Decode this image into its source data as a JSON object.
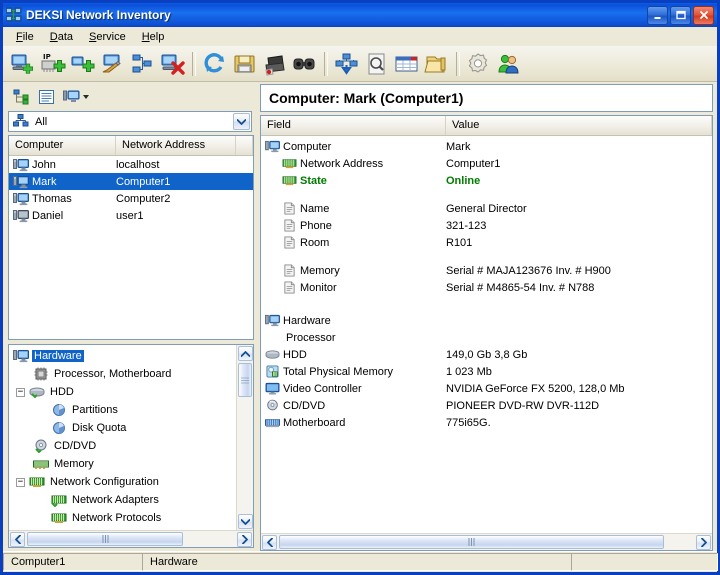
{
  "window": {
    "title": "DEKSI Network Inventory",
    "app_icon": "network-computers-icon",
    "buttons": {
      "minimize": "minimize-button",
      "maximize": "maximize-button",
      "close": "close-button"
    }
  },
  "menubar": [
    {
      "label": "File",
      "accel": "F"
    },
    {
      "label": "Data",
      "accel": "D"
    },
    {
      "label": "Service",
      "accel": "S"
    },
    {
      "label": "Help",
      "accel": "H"
    }
  ],
  "toolbar": {
    "groups": [
      [
        {
          "name": "add-computer-icon",
          "tip": "Add Computer"
        },
        {
          "name": "add-ip-range-icon",
          "tip": "Add IP Range"
        },
        {
          "name": "add-group-icon",
          "tip": "Add Group"
        },
        {
          "name": "edit-computer-icon",
          "tip": "Edit Computer"
        },
        {
          "name": "network-tree-icon",
          "tip": "Network Tree"
        },
        {
          "name": "delete-computer-icon",
          "tip": "Delete Computer"
        }
      ],
      [
        {
          "name": "refresh-icon",
          "tip": "Refresh"
        },
        {
          "name": "save-icon",
          "tip": "Save"
        },
        {
          "name": "print-icon",
          "tip": "Print"
        },
        {
          "name": "find-icon",
          "tip": "Find"
        }
      ],
      [
        {
          "name": "scan-download-icon",
          "tip": "Scan Network"
        },
        {
          "name": "preview-icon",
          "tip": "Preview"
        },
        {
          "name": "report-table-icon",
          "tip": "Reports"
        },
        {
          "name": "open-folder-icon",
          "tip": "Open Folder"
        }
      ],
      [
        {
          "name": "settings-gear-icon",
          "tip": "Settings"
        },
        {
          "name": "users-icon",
          "tip": "Users"
        }
      ]
    ]
  },
  "left_panel": {
    "view_toolbar": [
      {
        "name": "tree-view-icon"
      },
      {
        "name": "list-view-icon"
      },
      {
        "name": "computer-view-icon",
        "has_dropdown": true
      }
    ],
    "group_selector": {
      "icon": "network-group-icon",
      "value": "All",
      "placeholder": "All"
    },
    "computer_list": {
      "columns": [
        "Computer",
        "Network Address"
      ],
      "rows": [
        {
          "computer": "John",
          "address": "localhost",
          "selected": false,
          "icon": "computer-online-icon"
        },
        {
          "computer": "Mark",
          "address": "Computer1",
          "selected": true,
          "icon": "computer-online-icon"
        },
        {
          "computer": "Thomas",
          "address": "Computer2",
          "selected": false,
          "icon": "computer-online-icon"
        },
        {
          "computer": "Daniel",
          "address": "user1",
          "selected": false,
          "icon": "computer-offline-icon"
        }
      ]
    },
    "tree": {
      "nodes": [
        {
          "label": "Hardware",
          "depth": 0,
          "icon": "computer-icon",
          "expander": "",
          "selected": true
        },
        {
          "label": "Processor, Motherboard",
          "depth": 1,
          "icon": "cpu-icon",
          "expander": "",
          "selected": false
        },
        {
          "label": "HDD",
          "depth": 1,
          "icon": "hdd-icon",
          "expander": "-",
          "selected": false
        },
        {
          "label": "Partitions",
          "depth": 2,
          "icon": "partition-icon",
          "expander": "",
          "selected": false
        },
        {
          "label": "Disk Quota",
          "depth": 2,
          "icon": "partition-icon",
          "expander": "",
          "selected": false
        },
        {
          "label": "CD/DVD",
          "depth": 1,
          "icon": "cddvd-icon",
          "expander": "",
          "selected": false
        },
        {
          "label": "Memory",
          "depth": 1,
          "icon": "memory-icon",
          "expander": "",
          "selected": false
        },
        {
          "label": "Network Configuration",
          "depth": 1,
          "icon": "network-icon",
          "expander": "-",
          "selected": false
        },
        {
          "label": "Network Adapters",
          "depth": 2,
          "icon": "network-icon",
          "expander": "",
          "selected": false
        },
        {
          "label": "Network Protocols",
          "depth": 2,
          "icon": "network-icon",
          "expander": "",
          "selected": false
        }
      ]
    }
  },
  "right_panel": {
    "header": "Computer: Mark (Computer1)",
    "columns": [
      "Field",
      "Value"
    ],
    "rows": [
      {
        "field": "Computer",
        "value": "Mark",
        "indent": 0,
        "icon": "computer-icon",
        "bold": false,
        "green": false
      },
      {
        "field": "Network Address",
        "value": "Computer1",
        "indent": 1,
        "icon": "network-icon",
        "bold": false,
        "green": false
      },
      {
        "field": "State",
        "value": "Online",
        "indent": 1,
        "icon": "network-icon",
        "bold": true,
        "green": true
      },
      {
        "field": "",
        "value": "",
        "indent": 0,
        "icon": "",
        "spacer": true
      },
      {
        "field": "Name",
        "value": "General Director",
        "indent": 1,
        "icon": "document-icon",
        "bold": false,
        "green": false
      },
      {
        "field": "Phone",
        "value": "321-123",
        "indent": 1,
        "icon": "document-icon",
        "bold": false,
        "green": false
      },
      {
        "field": "Room",
        "value": "R101",
        "indent": 1,
        "icon": "document-icon",
        "bold": false,
        "green": false
      },
      {
        "field": "",
        "value": "",
        "indent": 0,
        "icon": "",
        "spacer": true
      },
      {
        "field": "Memory",
        "value": "Serial # MAJA123676 Inv. # H900",
        "indent": 1,
        "icon": "document-icon",
        "bold": false,
        "green": false
      },
      {
        "field": "Monitor",
        "value": "Serial # M4865-54 Inv. # N788",
        "indent": 1,
        "icon": "document-icon",
        "bold": false,
        "green": false
      },
      {
        "field": "",
        "value": "",
        "indent": 0,
        "icon": "",
        "spacer": true
      },
      {
        "field": "Hardware",
        "value": "",
        "indent": 0,
        "icon": "computer-icon",
        "bold": false,
        "green": false
      },
      {
        "field": "Processor",
        "value": "",
        "indent": 1,
        "icon": "",
        "bold": false,
        "green": false
      },
      {
        "field": "HDD",
        "value": "149,0 Gb 3,8 Gb",
        "indent": 0,
        "icon": "hdd-icon",
        "bold": false,
        "green": false
      },
      {
        "field": "Total Physical Memory",
        "value": "1 023 Mb",
        "indent": 0,
        "icon": "memory-chip-icon",
        "bold": false,
        "green": false
      },
      {
        "field": "Video Controller",
        "value": "NVIDIA GeForce FX 5200, 128,0 Mb",
        "indent": 0,
        "icon": "monitor-icon",
        "bold": false,
        "green": false
      },
      {
        "field": "CD/DVD",
        "value": "PIONEER DVD-RW  DVR-112D",
        "indent": 0,
        "icon": "cddvd-icon",
        "bold": false,
        "green": false
      },
      {
        "field": "Motherboard",
        "value": "775i65G.",
        "indent": 0,
        "icon": "motherboard-icon",
        "bold": false,
        "green": false
      }
    ]
  },
  "statusbar": {
    "cell1": "Computer1",
    "cell2": "Hardware",
    "cell3": ""
  },
  "colors": {
    "titlebar_blue": "#0a4fd8",
    "selection_blue": "#1063c8",
    "online_green": "#007c00",
    "face": "#ece9d8",
    "field_border": "#7f9db9"
  }
}
